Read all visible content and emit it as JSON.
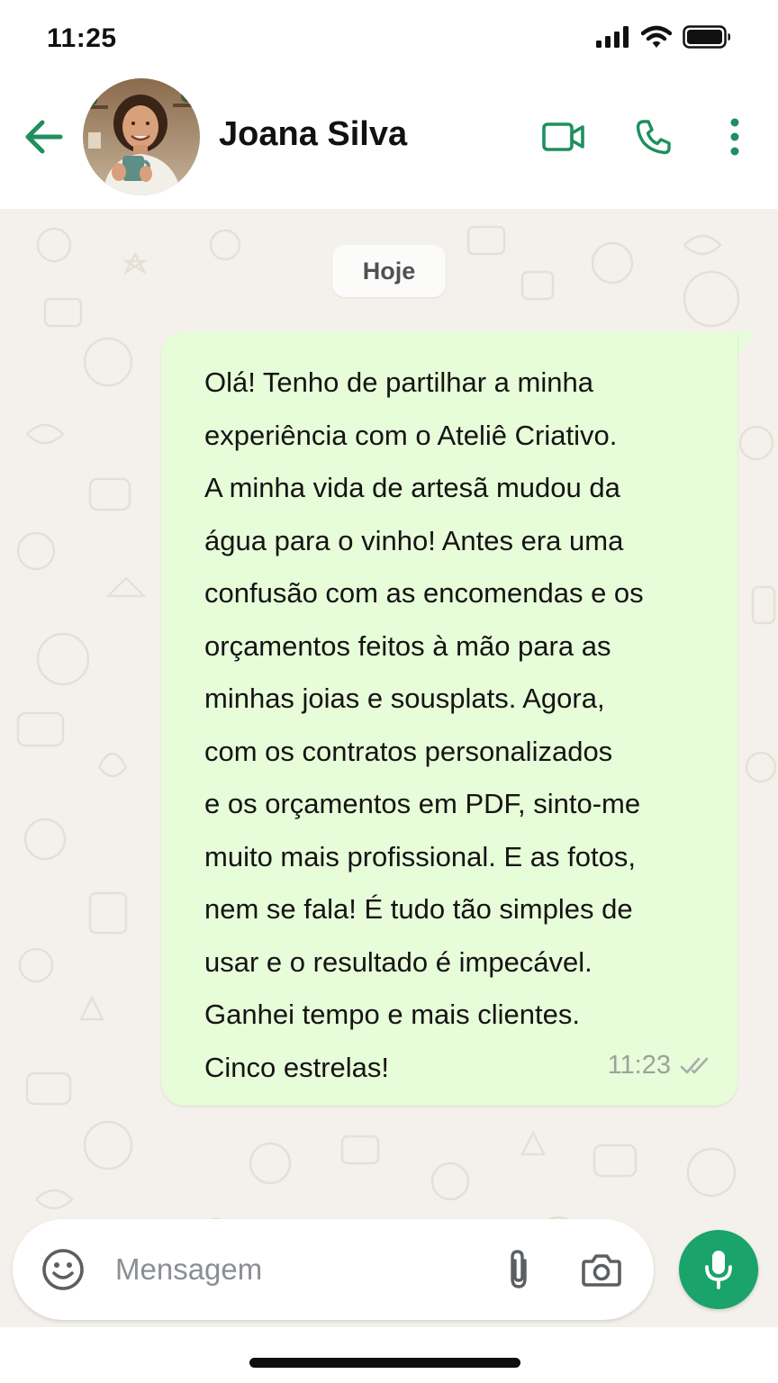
{
  "status_bar": {
    "time": "11:25"
  },
  "header": {
    "contact_name": "Joana Silva",
    "back_icon": "arrow-left-icon",
    "video_icon": "video-call-icon",
    "call_icon": "phone-icon",
    "menu_icon": "more-vertical-icon"
  },
  "chat": {
    "date_chip": "Hoje",
    "messages": [
      {
        "direction": "outgoing",
        "text": "Olá! Tenho de partilhar a minha\nexperiência com o Ateliê Criativo.\nA minha vida de artesã mudou da\nágua para o vinho! Antes era uma\nconfusão com as encomendas e os\norçamentos feitos à mão para as\nminhas joias e sousplats. Agora,\ncom os contratos personalizados\ne os orçamentos em PDF, sinto-me\nmuito mais profissional. E as fotos,\nnem se fala! É tudo tão simples de\nusar e o resultado é impecável.\nGanhei tempo e mais clientes.\nCinco estrelas!",
        "time": "11:23",
        "status_icon": "double-check-icon"
      }
    ]
  },
  "composer": {
    "placeholder": "Mensagem",
    "emoji_icon": "emoji-icon",
    "attach_icon": "paperclip-icon",
    "camera_icon": "camera-icon",
    "mic_icon": "microphone-icon"
  },
  "colors": {
    "accent_green": "#1aa36a",
    "icon_green": "#1f8f5f",
    "bubble_outgoing": "#e7fcd9",
    "chat_background": "#f4f1ec"
  }
}
